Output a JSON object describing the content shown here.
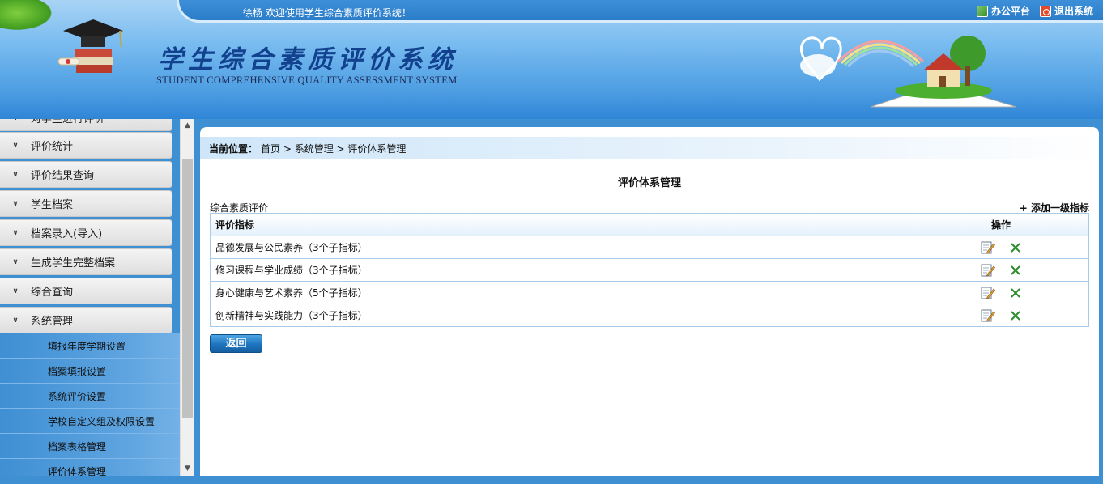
{
  "header": {
    "welcome": "徐杨 欢迎使用学生综合素质评价系统！",
    "office_link": "办公平台",
    "exit_link": "退出系统",
    "title": "学生综合素质评价系统",
    "subtitle": "STUDENT COMPREHENSIVE QUALITY ASSESSMENT SYSTEM"
  },
  "sidebar": {
    "groups": [
      {
        "label": "对学生进行评价"
      },
      {
        "label": "评价统计"
      },
      {
        "label": "评价结果查询"
      },
      {
        "label": "学生档案"
      },
      {
        "label": "档案录入(导入)"
      },
      {
        "label": "生成学生完整档案"
      },
      {
        "label": "综合查询"
      },
      {
        "label": "系统管理"
      }
    ],
    "sub_items": [
      {
        "label": "填报年度学期设置"
      },
      {
        "label": "档案填报设置"
      },
      {
        "label": "系统评价设置"
      },
      {
        "label": "学校自定义组及权限设置"
      },
      {
        "label": "档案表格管理"
      },
      {
        "label": "评价体系管理"
      }
    ]
  },
  "breadcrumb": {
    "label": "当前位置：",
    "path": "首页 > 系统管理 > 评价体系管理"
  },
  "main": {
    "title": "评价体系管理",
    "section_label": "综合素质评价",
    "add_link": "+ 添加一级指标",
    "table": {
      "headers": {
        "name": "评价指标",
        "ops": "操作"
      },
      "rows": [
        {
          "name": "品德发展与公民素养（3个子指标）"
        },
        {
          "name": "修习课程与学业成绩（3个子指标）"
        },
        {
          "name": "身心健康与艺术素养（5个子指标）"
        },
        {
          "name": "创新精神与实践能力（3个子指标）"
        }
      ]
    },
    "back_button": "返回"
  },
  "icons": {
    "edit": "edit-pencil-icon",
    "delete": "delete-x-icon",
    "menu_arrow": "double-chevron-down-icon"
  },
  "colors": {
    "header_blue": "#2f86d6",
    "title_blue": "#12418e",
    "grid_border": "#a9cbea",
    "delete_green": "#2e8b2e"
  }
}
